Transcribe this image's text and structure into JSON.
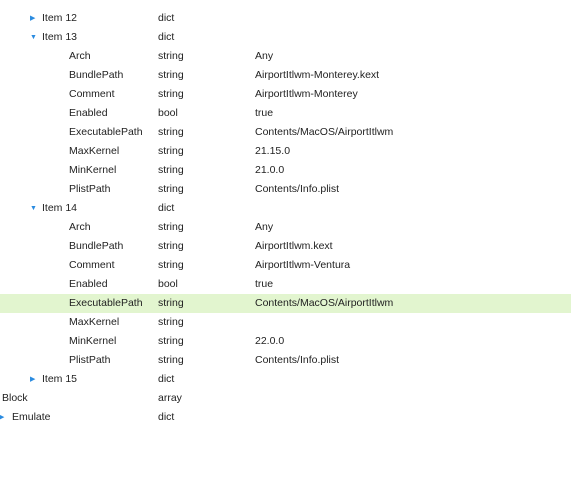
{
  "tree": {
    "rows": [
      {
        "key": "Item 12",
        "type": "dict",
        "value": "",
        "level": 1,
        "disclosure": "collapsed"
      },
      {
        "key": "Item 13",
        "type": "dict",
        "value": "",
        "level": 1,
        "disclosure": "expanded"
      },
      {
        "key": "Arch",
        "type": "string",
        "value": "Any",
        "level": 2,
        "disclosure": "none"
      },
      {
        "key": "BundlePath",
        "type": "string",
        "value": "AirportItlwm-Monterey.kext",
        "level": 2,
        "disclosure": "none"
      },
      {
        "key": "Comment",
        "type": "string",
        "value": "AirportItlwm-Monterey",
        "level": 2,
        "disclosure": "none"
      },
      {
        "key": "Enabled",
        "type": "bool",
        "value": "true",
        "level": 2,
        "disclosure": "none"
      },
      {
        "key": "ExecutablePath",
        "type": "string",
        "value": "Contents/MacOS/AirportItlwm",
        "level": 2,
        "disclosure": "none"
      },
      {
        "key": "MaxKernel",
        "type": "string",
        "value": "21.15.0",
        "level": 2,
        "disclosure": "none"
      },
      {
        "key": "MinKernel",
        "type": "string",
        "value": "21.0.0",
        "level": 2,
        "disclosure": "none"
      },
      {
        "key": "PlistPath",
        "type": "string",
        "value": "Contents/Info.plist",
        "level": 2,
        "disclosure": "none"
      },
      {
        "key": "Item 14",
        "type": "dict",
        "value": "",
        "level": 1,
        "disclosure": "expanded"
      },
      {
        "key": "Arch",
        "type": "string",
        "value": "Any",
        "level": 2,
        "disclosure": "none"
      },
      {
        "key": "BundlePath",
        "type": "string",
        "value": "AirportItlwm.kext",
        "level": 2,
        "disclosure": "none"
      },
      {
        "key": "Comment",
        "type": "string",
        "value": "AirportItlwm-Ventura",
        "level": 2,
        "disclosure": "none"
      },
      {
        "key": "Enabled",
        "type": "bool",
        "value": "true",
        "level": 2,
        "disclosure": "none"
      },
      {
        "key": "ExecutablePath",
        "type": "string",
        "value": "Contents/MacOS/AirportItlwm",
        "level": 2,
        "disclosure": "none",
        "selected": true
      },
      {
        "key": "MaxKernel",
        "type": "string",
        "value": "",
        "level": 2,
        "disclosure": "none"
      },
      {
        "key": "MinKernel",
        "type": "string",
        "value": "22.0.0",
        "level": 2,
        "disclosure": "none"
      },
      {
        "key": "PlistPath",
        "type": "string",
        "value": "Contents/Info.plist",
        "level": 2,
        "disclosure": "none"
      },
      {
        "key": "Item 15",
        "type": "dict",
        "value": "",
        "level": 1,
        "disclosure": "collapsed"
      },
      {
        "key": "Block",
        "type": "array",
        "value": "",
        "level": 0,
        "disclosure": "none"
      },
      {
        "key": "Emulate",
        "type": "dict",
        "value": "",
        "level": 0,
        "disclosure": "collapsed",
        "clipped": true
      }
    ]
  },
  "icons": {
    "collapsed": "disclosure-triangle-right-icon",
    "expanded": "disclosure-triangle-down-icon"
  },
  "colors": {
    "selected_row": "#e2f5cf",
    "disclosure": "#2a8be0",
    "text": "#222222"
  }
}
